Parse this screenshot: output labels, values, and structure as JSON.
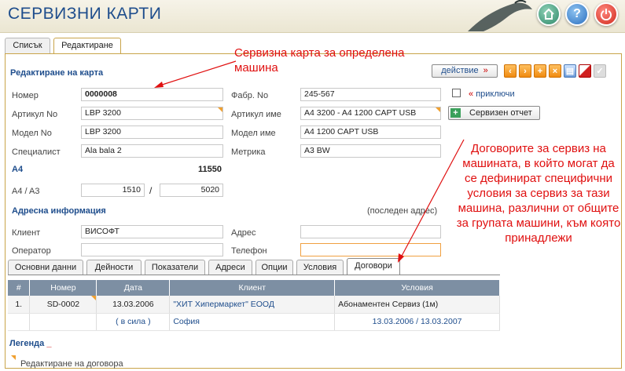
{
  "header": {
    "title": "СЕРВИЗНИ КАРТИ",
    "buttons": {
      "home": "home-icon",
      "help": "?",
      "power": "power-icon"
    }
  },
  "top_tabs": [
    "Списък",
    "Редактиране"
  ],
  "edit": {
    "section_title": "Редактиране на карта",
    "action_label": "действие",
    "action_arrow": "»",
    "toolbar": [
      "‹",
      "›",
      "+",
      "×",
      "▤",
      "",
      "✓"
    ],
    "fields": {
      "nomer": {
        "label": "Номер",
        "value": "0000008"
      },
      "fabr_no": {
        "label": "Фабр. No",
        "value": "245-567"
      },
      "artikul_no": {
        "label": "Артикул No",
        "value": "LBP 3200"
      },
      "artikul_ime": {
        "label": "Артикул име",
        "value": "A4 3200 - A4 1200 CAPT USB"
      },
      "model_no": {
        "label": "Модел No",
        "value": "LBP 3200"
      },
      "model_ime": {
        "label": "Модел име",
        "value": "A4 1200 CAPT USB"
      },
      "specialist": {
        "label": "Специалист",
        "value": "Ala bala 2"
      },
      "metrika": {
        "label": "Метрика",
        "value": "A3 BW"
      }
    },
    "closed_checkbox": {
      "quote": "«",
      "label": "приключи"
    },
    "report_button": "Сервизен отчет"
  },
  "counters": {
    "title": "A4",
    "total": "11550",
    "row_label": "A4 / A3",
    "a4": "1510",
    "separator": "/",
    "a3": "5020"
  },
  "address": {
    "section_title": "Адресна информация",
    "hint": "(последен адрес)",
    "fields": {
      "client": {
        "label": "Клиент",
        "value": "ВИСОФТ"
      },
      "address": {
        "label": "Адрес",
        "value": ""
      },
      "operator": {
        "label": "Оператор",
        "value": ""
      },
      "phone": {
        "label": "Телефон",
        "value": ""
      }
    }
  },
  "subtabs": [
    "Основни данни",
    "Дейности",
    "Показатели",
    "Адреси",
    "Опции",
    "Условия",
    "Договори"
  ],
  "active_subtab": "Договори",
  "contracts_table": {
    "columns": [
      "#",
      "Номер",
      "Дата",
      "Клиент",
      "Условия"
    ],
    "rows": [
      {
        "n": "1.",
        "nomer": "SD-0002",
        "date": "13.03.2006",
        "date_status": "( в сила )",
        "client": "\"ХИТ Хипермаркет\" ЕООД",
        "city": "София",
        "conditions": "Абонаментен Сервиз (1м)",
        "period": "13.03.2006 / 13.03.2007"
      }
    ]
  },
  "legend": {
    "title": "Легенда",
    "underscore": "_",
    "item": "Редактиране на договора"
  },
  "annotations": {
    "note1": "Сервизна карта за определена машина",
    "note2": "Договорите за сервиз на машината, в който могат да се дефинират специфични условия за сервиз за тази машина, различни от общите за групата машини, към която принадлежи"
  },
  "colors": {
    "brand_blue": "#1e4d8c",
    "annotation_red": "#e01010",
    "accent_orange": "#f0a030",
    "table_header": "#7d8fa3"
  }
}
